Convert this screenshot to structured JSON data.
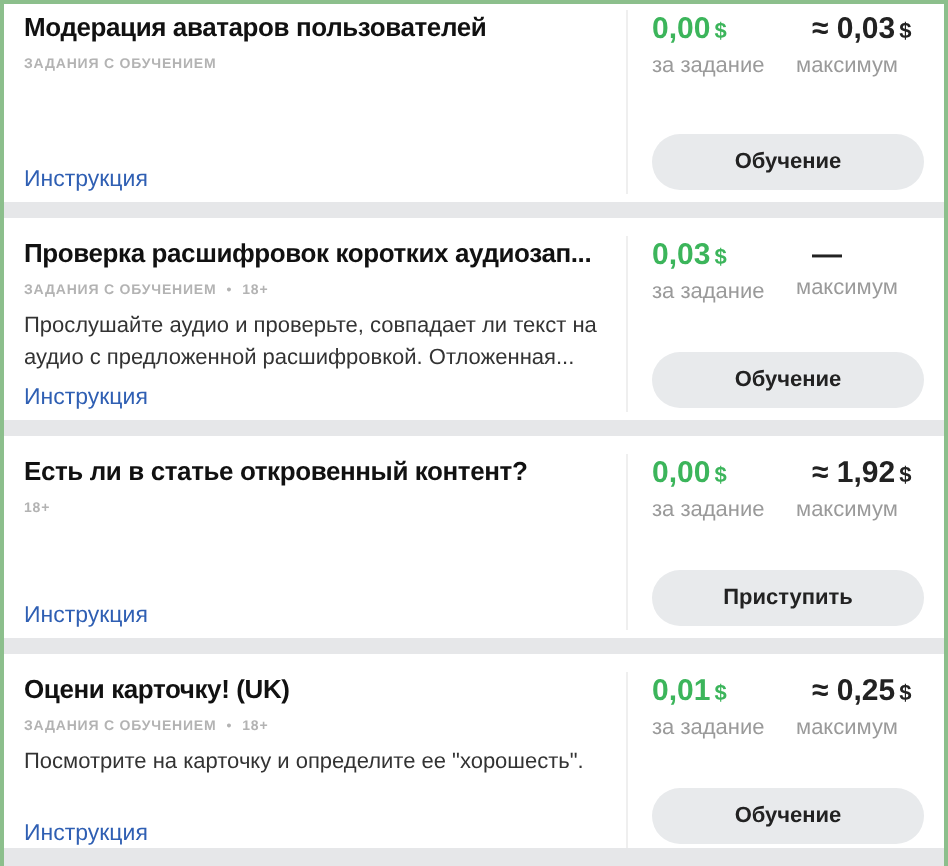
{
  "tasks": [
    {
      "title": "Модерация аватаров пользователей",
      "meta": [
        "ЗАДАНИЯ С ОБУЧЕНИЕМ"
      ],
      "link": "Инструкция",
      "price": {
        "value": "0,00",
        "currency": "$",
        "label": "за задание"
      },
      "max": {
        "value": "≈ 0,03",
        "currency": "$",
        "label": "максимум"
      },
      "button": "Обучение"
    },
    {
      "title": "Проверка расшифровок коротких аудиозап...",
      "meta": [
        "ЗАДАНИЯ С ОБУЧЕНИЕМ",
        "•",
        "18+"
      ],
      "description": "Прослушайте аудио и проверьте, совпадает ли текст на аудио с предложенной расшифровкой. Отложенная...",
      "link": "Инструкция",
      "price": {
        "value": "0,03",
        "currency": "$",
        "label": "за задание"
      },
      "max": {
        "value": "—",
        "label": "максимум"
      },
      "button": "Обучение"
    },
    {
      "title": "Есть ли в статье откровенный контент?",
      "meta": [
        "18+"
      ],
      "link": "Инструкция",
      "price": {
        "value": "0,00",
        "currency": "$",
        "label": "за задание"
      },
      "max": {
        "value": "≈ 1,92",
        "currency": "$",
        "label": "максимум"
      },
      "button": "Приступить"
    },
    {
      "title": "Оцени карточку! (UK)",
      "meta": [
        "ЗАДАНИЯ С ОБУЧЕНИЕМ",
        "•",
        "18+"
      ],
      "description": "Посмотрите на карточку и определите ее \"хорошесть\".",
      "link": "Инструкция",
      "price": {
        "value": "0,01",
        "currency": "$",
        "label": "за задание"
      },
      "max": {
        "value": "≈ 0,25",
        "currency": "$",
        "label": "максимум"
      },
      "button": "Обучение"
    }
  ]
}
